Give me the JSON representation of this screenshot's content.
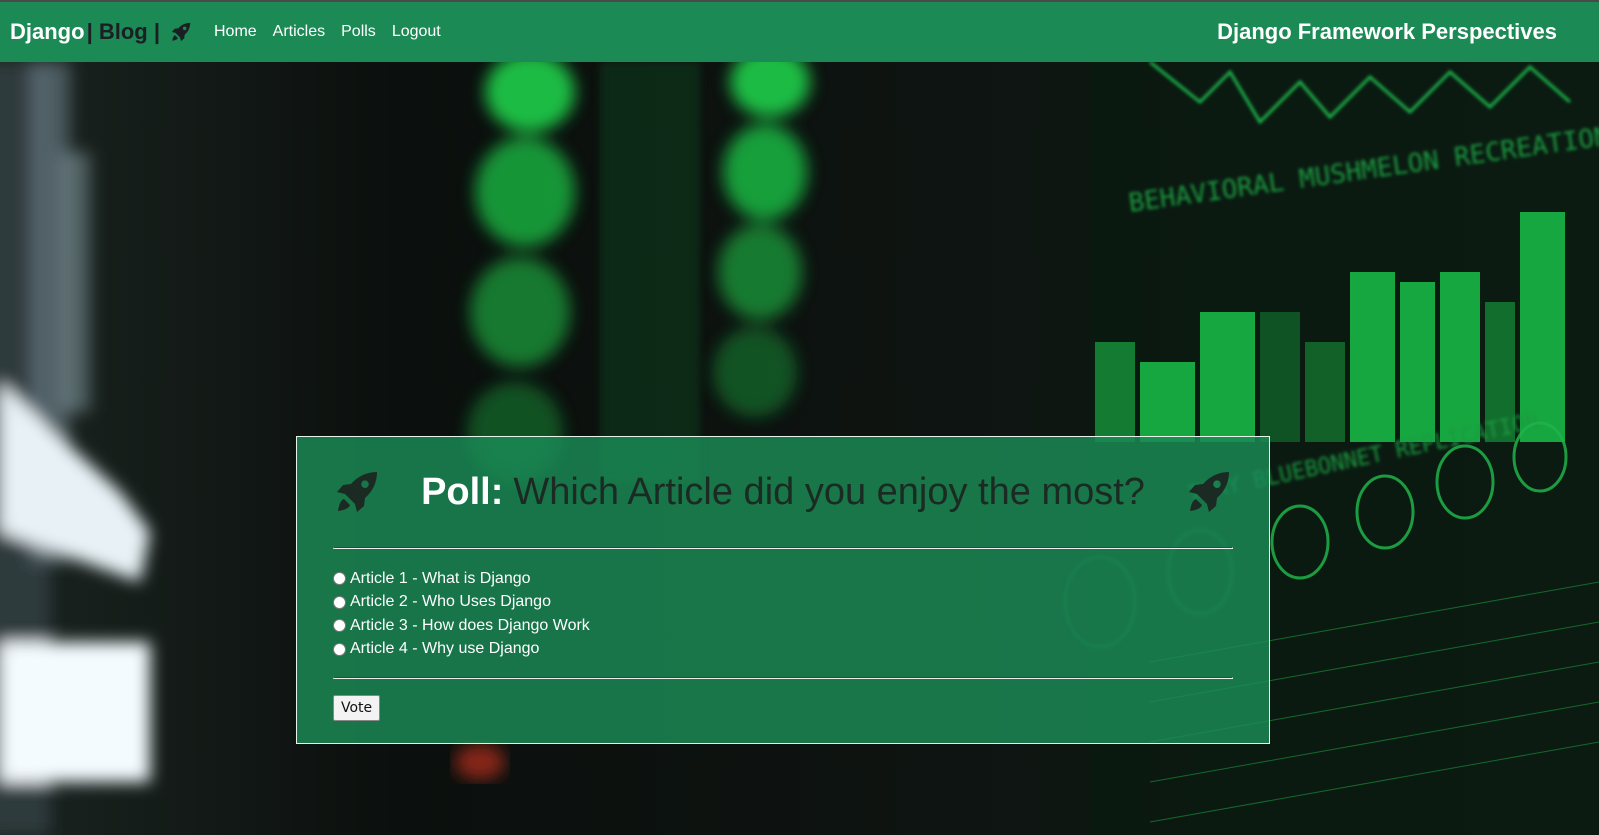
{
  "navbar": {
    "brand_part1": "Django",
    "brand_part2": "| Blog |",
    "brand_icon": "rocket-icon",
    "links": [
      "Home",
      "Articles",
      "Polls",
      "Logout"
    ],
    "site_title": "Django Framework Perspectives",
    "bg_color": "#1b8a55"
  },
  "poll": {
    "label": "Poll:",
    "question": "Which Article did you enjoy the most?",
    "left_icon": "rocket-icon",
    "right_icon": "rocket-icon",
    "options": [
      "Article 1 - What is Django",
      "Article 2 - Who Uses Django",
      "Article 3 - How does Django Work",
      "Article 4 - Why use Django"
    ],
    "vote_label": "Vote"
  },
  "background": {
    "texts": [
      "BEHAVIORAL MUSHMELON RECREATION",
      "TORY BLUEBONNET REPLICATION"
    ]
  }
}
